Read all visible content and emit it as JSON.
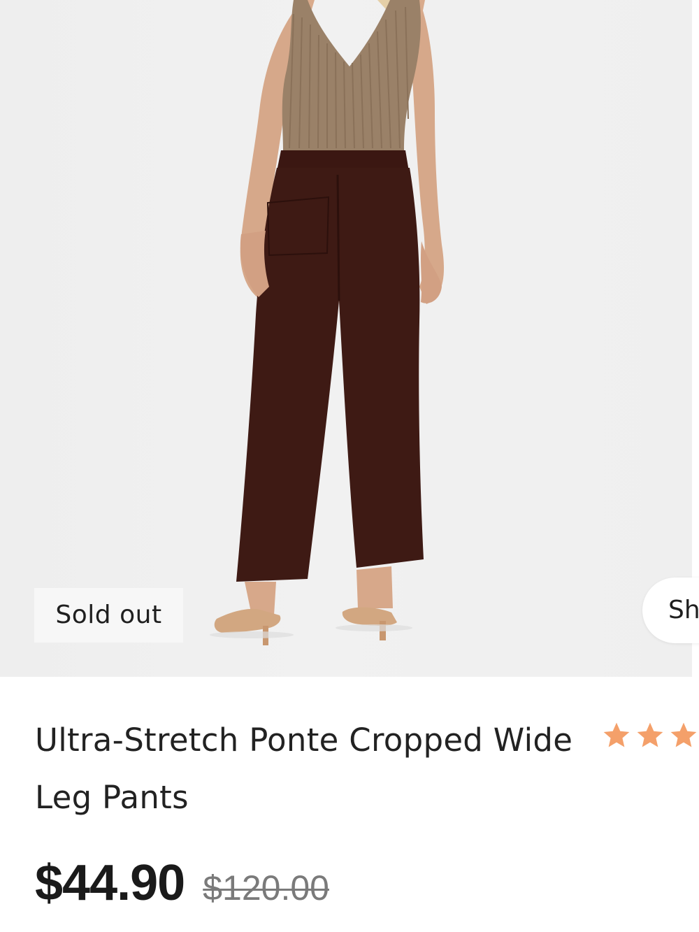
{
  "product": {
    "badge": "Sold out",
    "side_action_label": "Shop",
    "title": "Ultra-Stretch Ponte Cropped Wide Leg Pants",
    "price": "$44.90",
    "compare_at_price": "$120.00",
    "rating_stars_visible": 3,
    "star_color": "#f4a06a"
  },
  "image": {
    "description_icon": "product-photo",
    "colors": {
      "background": "#efefef",
      "pants": "#3e1a14",
      "top": "#9a8168",
      "skin": "#d7a88a",
      "sandals": "#d2a781"
    }
  }
}
